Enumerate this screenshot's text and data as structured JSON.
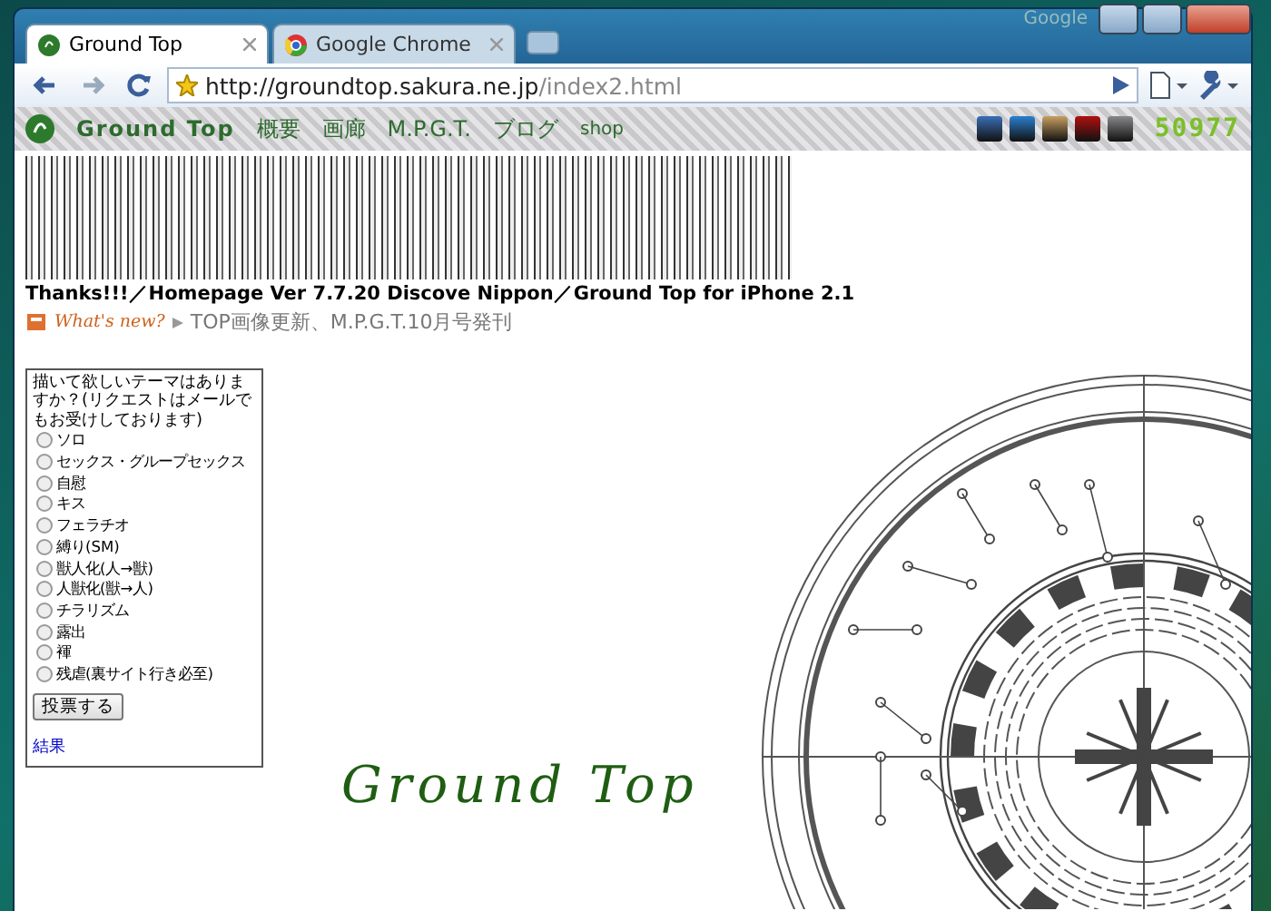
{
  "window": {
    "brand": "Google"
  },
  "tabs": [
    {
      "title": "Ground Top",
      "selected": true
    },
    {
      "title": "Google Chrome",
      "selected": false
    }
  ],
  "address": {
    "host": "http://groundtop.sakura.ne.jp",
    "path": "/index2.html"
  },
  "page": {
    "nav": {
      "logo_text": "Ground Top",
      "links": [
        "概要",
        "画廊",
        "M.P.G.T.",
        "ブログ",
        "shop"
      ],
      "counter": "50977"
    },
    "announcement": "Thanks!!!／Homepage Ver 7.7.20 Discove Nippon／Ground Top for iPhone 2.1",
    "whats_new": {
      "label": "What's new?",
      "text": "TOP画像更新、M.P.G.T.10月号発刊"
    },
    "poll": {
      "question": "描いて欲しいテーマはありますか？(リクエストはメールでもお受けしております)",
      "options": [
        {
          "label": "ソロ",
          "selected": false
        },
        {
          "label": "セックス・グループセックス",
          "selected": false
        },
        {
          "label": "自慰",
          "selected": false
        },
        {
          "label": "キス",
          "selected": false
        },
        {
          "label": "フェラチオ",
          "selected": false
        },
        {
          "label": "縛り(SM)",
          "selected": false
        },
        {
          "label": "獣人化(人→獣)",
          "selected": false
        },
        {
          "label": "人獣化(獣→人)",
          "selected": false
        },
        {
          "label": "チラリズム",
          "selected": false
        },
        {
          "label": "露出",
          "selected": false
        },
        {
          "label": "褌",
          "selected": false
        },
        {
          "label": "残虐(裏サイト行き必至)",
          "selected": false
        }
      ],
      "submit": "投票する",
      "results_link": "結果"
    },
    "logo_title": "Ground Top"
  }
}
